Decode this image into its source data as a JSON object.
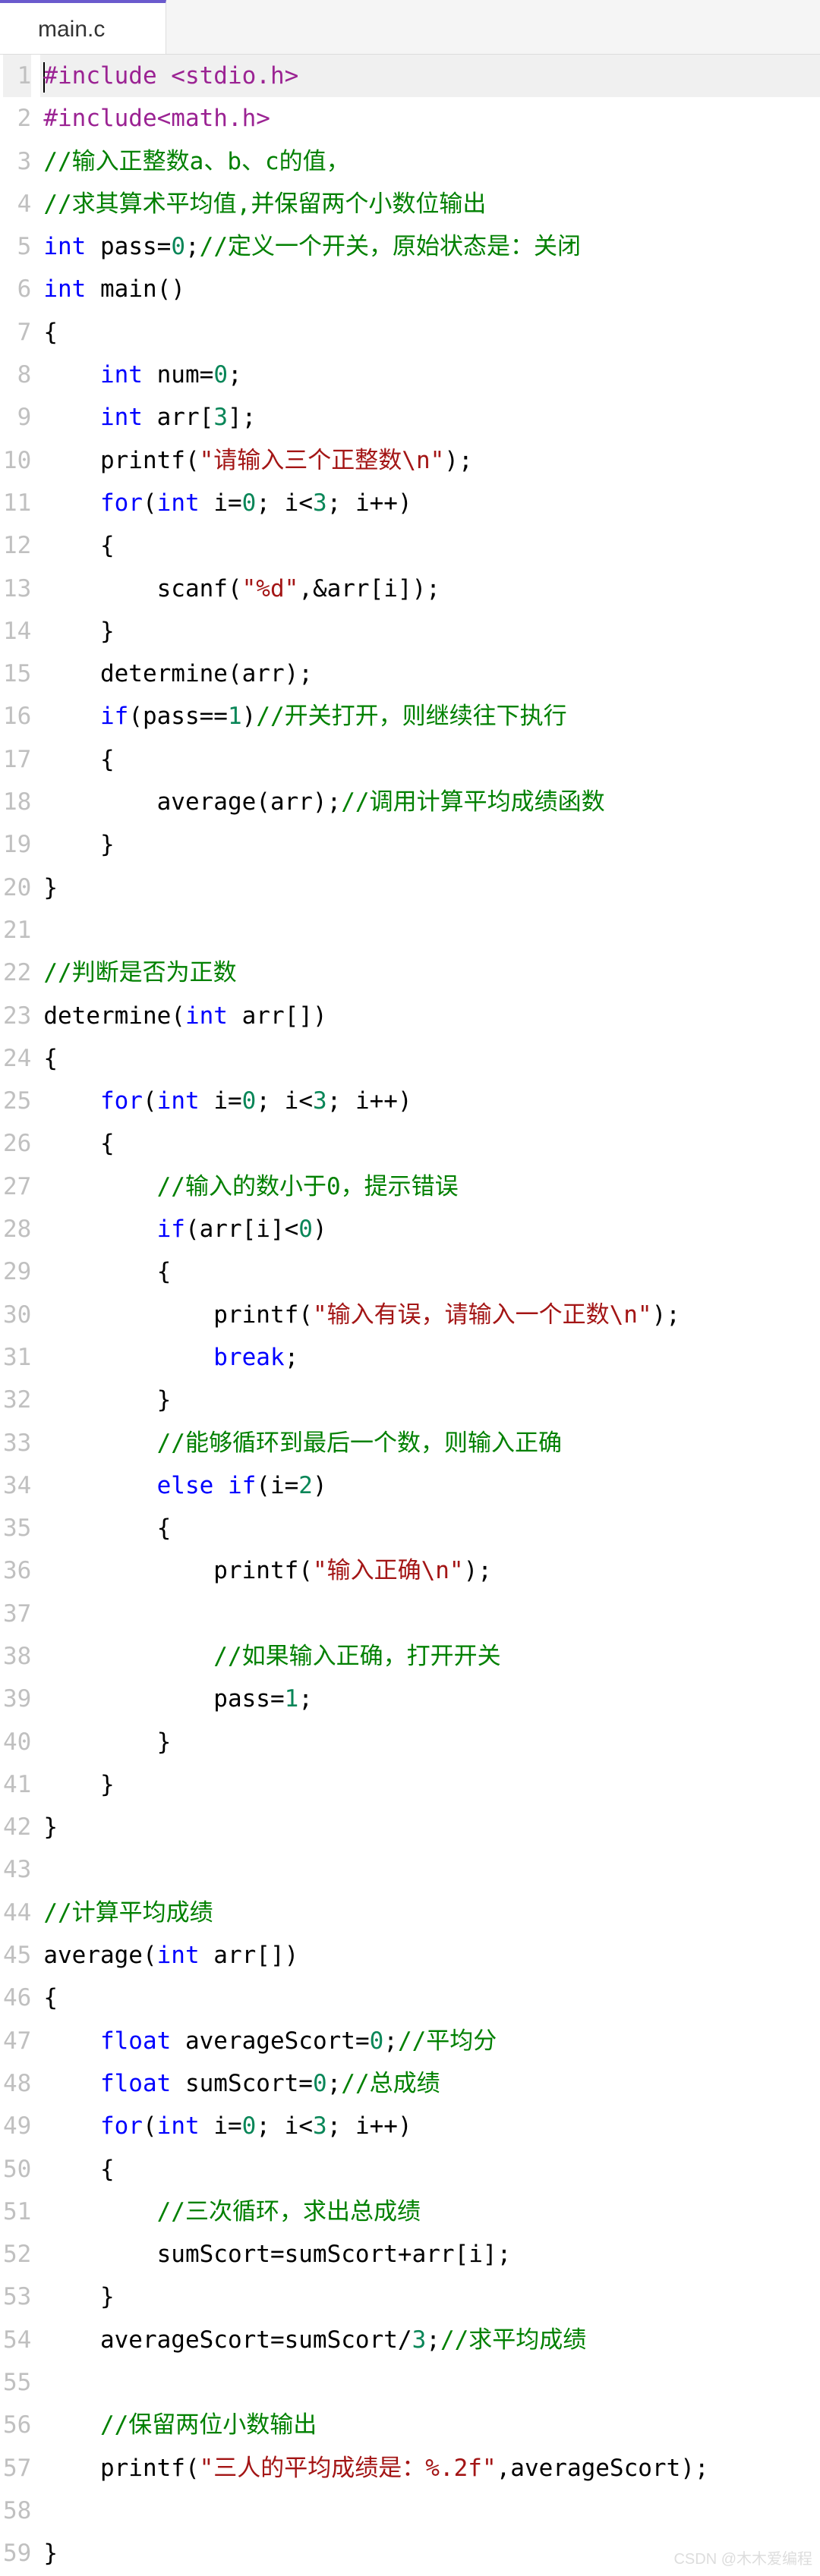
{
  "tab": {
    "filename": "main.c"
  },
  "watermark": "CSDN @木木爱编程",
  "lines": [
    {
      "n": 1,
      "current": true,
      "tokens": [
        {
          "c": "cursor",
          "t": ""
        },
        {
          "c": "pp",
          "t": "#include <stdio.h>"
        }
      ]
    },
    {
      "n": 2,
      "tokens": [
        {
          "c": "pp",
          "t": "#include<math.h>"
        }
      ]
    },
    {
      "n": 3,
      "tokens": [
        {
          "c": "cm",
          "t": "//输入正整数a、b、c的值，"
        }
      ]
    },
    {
      "n": 4,
      "tokens": [
        {
          "c": "cm",
          "t": "//求其算术平均值,并保留两个小数位输出"
        }
      ]
    },
    {
      "n": 5,
      "tokens": [
        {
          "c": "kw",
          "t": "int"
        },
        {
          "t": " pass="
        },
        {
          "c": "nu",
          "t": "0"
        },
        {
          "t": ";"
        },
        {
          "c": "cm",
          "t": "//定义一个开关，原始状态是：关闭"
        }
      ]
    },
    {
      "n": 6,
      "tokens": [
        {
          "c": "kw",
          "t": "int"
        },
        {
          "t": " main()"
        }
      ]
    },
    {
      "n": 7,
      "tokens": [
        {
          "t": "{"
        }
      ]
    },
    {
      "n": 8,
      "tokens": [
        {
          "t": "    "
        },
        {
          "c": "kw",
          "t": "int"
        },
        {
          "t": " num="
        },
        {
          "c": "nu",
          "t": "0"
        },
        {
          "t": ";"
        }
      ]
    },
    {
      "n": 9,
      "tokens": [
        {
          "t": "    "
        },
        {
          "c": "kw",
          "t": "int"
        },
        {
          "t": " arr["
        },
        {
          "c": "nu",
          "t": "3"
        },
        {
          "t": "];"
        }
      ]
    },
    {
      "n": 10,
      "tokens": [
        {
          "t": "    printf("
        },
        {
          "c": "st",
          "t": "\"请输入三个正整数\\n\""
        },
        {
          "t": ");"
        }
      ]
    },
    {
      "n": 11,
      "tokens": [
        {
          "t": "    "
        },
        {
          "c": "kw",
          "t": "for"
        },
        {
          "t": "("
        },
        {
          "c": "kw",
          "t": "int"
        },
        {
          "t": " i="
        },
        {
          "c": "nu",
          "t": "0"
        },
        {
          "t": "; i<"
        },
        {
          "c": "nu",
          "t": "3"
        },
        {
          "t": "; i++)"
        }
      ]
    },
    {
      "n": 12,
      "tokens": [
        {
          "t": "    {"
        }
      ]
    },
    {
      "n": 13,
      "tokens": [
        {
          "t": "        scanf("
        },
        {
          "c": "st",
          "t": "\"%d\""
        },
        {
          "t": ",&arr[i]);"
        }
      ]
    },
    {
      "n": 14,
      "tokens": [
        {
          "t": "    }"
        }
      ]
    },
    {
      "n": 15,
      "tokens": [
        {
          "t": "    determine(arr);"
        }
      ]
    },
    {
      "n": 16,
      "tokens": [
        {
          "t": "    "
        },
        {
          "c": "kw",
          "t": "if"
        },
        {
          "t": "(pass=="
        },
        {
          "c": "nu",
          "t": "1"
        },
        {
          "t": ")"
        },
        {
          "c": "cm",
          "t": "//开关打开，则继续往下执行"
        }
      ]
    },
    {
      "n": 17,
      "tokens": [
        {
          "t": "    {"
        }
      ]
    },
    {
      "n": 18,
      "tokens": [
        {
          "t": "        average(arr);"
        },
        {
          "c": "cm",
          "t": "//调用计算平均成绩函数"
        }
      ]
    },
    {
      "n": 19,
      "tokens": [
        {
          "t": "    }"
        }
      ]
    },
    {
      "n": 20,
      "tokens": [
        {
          "t": "}"
        }
      ]
    },
    {
      "n": 21,
      "tokens": []
    },
    {
      "n": 22,
      "tokens": [
        {
          "c": "cm",
          "t": "//判断是否为正数"
        }
      ]
    },
    {
      "n": 23,
      "tokens": [
        {
          "t": "determine("
        },
        {
          "c": "kw",
          "t": "int"
        },
        {
          "t": " arr[])"
        }
      ]
    },
    {
      "n": 24,
      "tokens": [
        {
          "t": "{"
        }
      ]
    },
    {
      "n": 25,
      "tokens": [
        {
          "t": "    "
        },
        {
          "c": "kw",
          "t": "for"
        },
        {
          "t": "("
        },
        {
          "c": "kw",
          "t": "int"
        },
        {
          "t": " i="
        },
        {
          "c": "nu",
          "t": "0"
        },
        {
          "t": "; i<"
        },
        {
          "c": "nu",
          "t": "3"
        },
        {
          "t": "; i++)"
        }
      ]
    },
    {
      "n": 26,
      "tokens": [
        {
          "t": "    {"
        }
      ]
    },
    {
      "n": 27,
      "tokens": [
        {
          "t": "        "
        },
        {
          "c": "cm",
          "t": "//输入的数小于0，提示错误"
        }
      ]
    },
    {
      "n": 28,
      "tokens": [
        {
          "t": "        "
        },
        {
          "c": "kw",
          "t": "if"
        },
        {
          "t": "(arr[i]<"
        },
        {
          "c": "nu",
          "t": "0"
        },
        {
          "t": ")"
        }
      ]
    },
    {
      "n": 29,
      "tokens": [
        {
          "t": "        {"
        }
      ]
    },
    {
      "n": 30,
      "tokens": [
        {
          "t": "            printf("
        },
        {
          "c": "st",
          "t": "\"输入有误，请输入一个正数\\n\""
        },
        {
          "t": ");"
        }
      ]
    },
    {
      "n": 31,
      "tokens": [
        {
          "t": "            "
        },
        {
          "c": "kw",
          "t": "break"
        },
        {
          "t": ";"
        }
      ]
    },
    {
      "n": 32,
      "tokens": [
        {
          "t": "        }"
        }
      ]
    },
    {
      "n": 33,
      "tokens": [
        {
          "t": "        "
        },
        {
          "c": "cm",
          "t": "//能够循环到最后一个数，则输入正确"
        }
      ]
    },
    {
      "n": 34,
      "tokens": [
        {
          "t": "        "
        },
        {
          "c": "kw",
          "t": "else"
        },
        {
          "t": " "
        },
        {
          "c": "kw",
          "t": "if"
        },
        {
          "t": "(i="
        },
        {
          "c": "nu",
          "t": "2"
        },
        {
          "t": ")"
        }
      ]
    },
    {
      "n": 35,
      "tokens": [
        {
          "t": "        {"
        }
      ]
    },
    {
      "n": 36,
      "tokens": [
        {
          "t": "            printf("
        },
        {
          "c": "st",
          "t": "\"输入正确\\n\""
        },
        {
          "t": ");"
        }
      ]
    },
    {
      "n": 37,
      "tokens": []
    },
    {
      "n": 38,
      "tokens": [
        {
          "t": "            "
        },
        {
          "c": "cm",
          "t": "//如果输入正确，打开开关"
        }
      ]
    },
    {
      "n": 39,
      "tokens": [
        {
          "t": "            pass="
        },
        {
          "c": "nu",
          "t": "1"
        },
        {
          "t": ";"
        }
      ]
    },
    {
      "n": 40,
      "tokens": [
        {
          "t": "        }"
        }
      ]
    },
    {
      "n": 41,
      "tokens": [
        {
          "t": "    }"
        }
      ]
    },
    {
      "n": 42,
      "tokens": [
        {
          "t": "}"
        }
      ]
    },
    {
      "n": 43,
      "tokens": []
    },
    {
      "n": 44,
      "tokens": [
        {
          "c": "cm",
          "t": "//计算平均成绩"
        }
      ]
    },
    {
      "n": 45,
      "tokens": [
        {
          "t": "average("
        },
        {
          "c": "kw",
          "t": "int"
        },
        {
          "t": " arr[])"
        }
      ]
    },
    {
      "n": 46,
      "tokens": [
        {
          "t": "{"
        }
      ]
    },
    {
      "n": 47,
      "tokens": [
        {
          "t": "    "
        },
        {
          "c": "kw",
          "t": "float"
        },
        {
          "t": " averageScort="
        },
        {
          "c": "nu",
          "t": "0"
        },
        {
          "t": ";"
        },
        {
          "c": "cm",
          "t": "//平均分"
        }
      ]
    },
    {
      "n": 48,
      "tokens": [
        {
          "t": "    "
        },
        {
          "c": "kw",
          "t": "float"
        },
        {
          "t": " sumScort="
        },
        {
          "c": "nu",
          "t": "0"
        },
        {
          "t": ";"
        },
        {
          "c": "cm",
          "t": "//总成绩"
        }
      ]
    },
    {
      "n": 49,
      "tokens": [
        {
          "t": "    "
        },
        {
          "c": "kw",
          "t": "for"
        },
        {
          "t": "("
        },
        {
          "c": "kw",
          "t": "int"
        },
        {
          "t": " i="
        },
        {
          "c": "nu",
          "t": "0"
        },
        {
          "t": "; i<"
        },
        {
          "c": "nu",
          "t": "3"
        },
        {
          "t": "; i++)"
        }
      ]
    },
    {
      "n": 50,
      "tokens": [
        {
          "t": "    {"
        }
      ]
    },
    {
      "n": 51,
      "tokens": [
        {
          "t": "        "
        },
        {
          "c": "cm",
          "t": "//三次循环，求出总成绩"
        }
      ]
    },
    {
      "n": 52,
      "tokens": [
        {
          "t": "        sumScort=sumScort+arr[i];"
        }
      ]
    },
    {
      "n": 53,
      "tokens": [
        {
          "t": "    }"
        }
      ]
    },
    {
      "n": 54,
      "tokens": [
        {
          "t": "    averageScort=sumScort/"
        },
        {
          "c": "nu",
          "t": "3"
        },
        {
          "t": ";"
        },
        {
          "c": "cm",
          "t": "//求平均成绩"
        }
      ]
    },
    {
      "n": 55,
      "tokens": []
    },
    {
      "n": 56,
      "tokens": [
        {
          "t": "    "
        },
        {
          "c": "cm",
          "t": "//保留两位小数输出"
        }
      ]
    },
    {
      "n": 57,
      "tokens": [
        {
          "t": "    printf("
        },
        {
          "c": "st",
          "t": "\"三人的平均成绩是：%.2f\""
        },
        {
          "t": ",averageScort);"
        }
      ]
    },
    {
      "n": 58,
      "tokens": []
    },
    {
      "n": 59,
      "tokens": [
        {
          "t": "}"
        }
      ]
    }
  ]
}
